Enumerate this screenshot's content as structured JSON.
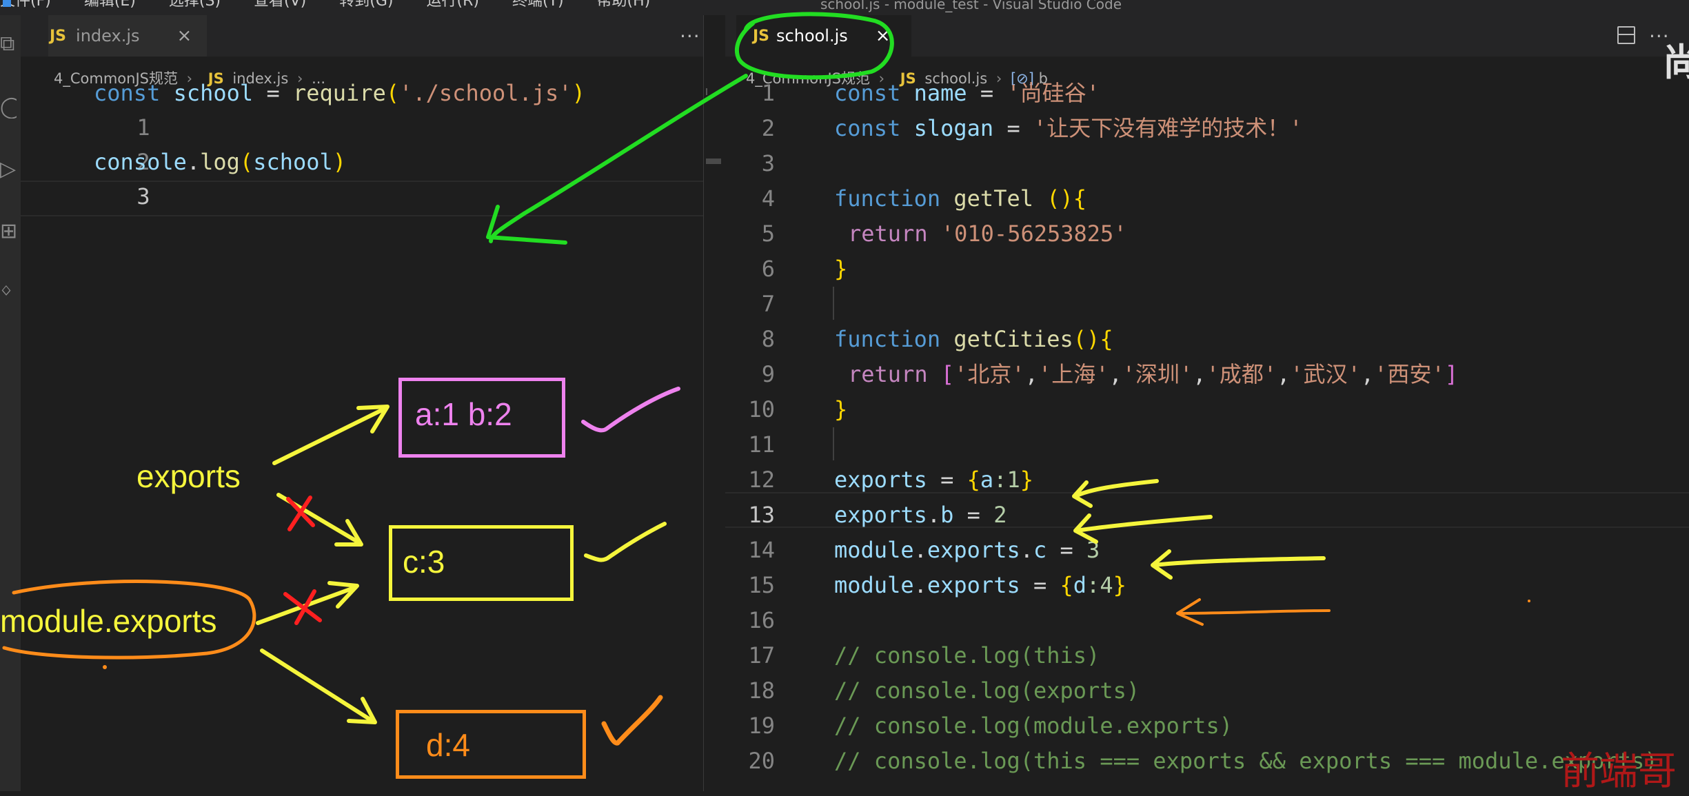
{
  "window": {
    "title": "school.js - module_test - Visual Studio Code",
    "menu": [
      "文件(F)",
      "编辑(E)",
      "选择(S)",
      "查看(V)",
      "转到(G)",
      "运行(R)",
      "终端(T)",
      "帮助(H)"
    ]
  },
  "left_editor": {
    "tab": {
      "badge": "JS",
      "label": "index.js",
      "close": "×"
    },
    "more": "···",
    "breadcrumb": {
      "folder": "4_CommonJS规范",
      "badge": "JS",
      "file": "index.js",
      "tail": "..."
    },
    "lines": [
      {
        "n": "1",
        "t1": "const",
        "t2": "school",
        "t3": " = ",
        "t4": "require",
        "t5": "(",
        "t6": "'./school.js'",
        "t7": ")"
      },
      {
        "n": "2"
      },
      {
        "n": "3",
        "t1": "console",
        "t2": ".",
        "t3": "log",
        "t4": "(",
        "t5": "school",
        "t6": ")"
      }
    ]
  },
  "right_editor": {
    "tab": {
      "badge": "JS",
      "label": "school.js",
      "close": "×"
    },
    "more": "···",
    "breadcrumb": {
      "folder": "4_CommonJS规范",
      "badge": "JS",
      "file": "school.js",
      "symbol_icon": "[⊘]",
      "symbol": "b"
    },
    "lines": [
      {
        "n": "1",
        "a": "const",
        "b": "name",
        "c": " = ",
        "d": "'尚硅谷'"
      },
      {
        "n": "2",
        "a": "const",
        "b": "slogan",
        "c": " = ",
        "d": "'让天下没有难学的技术！'"
      },
      {
        "n": "3"
      },
      {
        "n": "4",
        "a": "function",
        "b": "getTel",
        "c": " ",
        "d": "(){"
      },
      {
        "n": "5",
        "a": "return",
        "b": "'010-56253825'"
      },
      {
        "n": "6",
        "a": "}"
      },
      {
        "n": "7"
      },
      {
        "n": "8",
        "a": "function",
        "b": "getCities",
        "c": "(){"
      },
      {
        "n": "9",
        "a": "return",
        "b": "[",
        "c": "'北京'",
        "d": "'上海'",
        "e": "'深圳'",
        "f": "'成都'",
        "g": "'武汉'",
        "h": "'西安'",
        "i": "]",
        "sep": ","
      },
      {
        "n": "10",
        "a": "}"
      },
      {
        "n": "11"
      },
      {
        "n": "12",
        "a": "exports",
        "b": " = ",
        "c": "{",
        "d": "a",
        "e": ":1",
        "f": "}"
      },
      {
        "n": "13",
        "a": "exports",
        "b": ".",
        "c": "b",
        "d": " = ",
        "e": "2"
      },
      {
        "n": "14",
        "a": "module",
        "b": ".",
        "c": "exports",
        "d": ".",
        "e": "c",
        "f": " = ",
        "g": "3"
      },
      {
        "n": "15",
        "a": "module",
        "b": ".",
        "c": "exports",
        "d": " = ",
        "e": "{",
        "f": "d",
        "g": ":4",
        "h": "}"
      },
      {
        "n": "16"
      },
      {
        "n": "17",
        "a": "// console.log(this)"
      },
      {
        "n": "18",
        "a": "// console.log(exports)"
      },
      {
        "n": "19",
        "a": "// console.log(module.exports)"
      },
      {
        "n": "20",
        "a": "// console.log(this === exports && exports === module.exports)"
      }
    ]
  },
  "annotations": {
    "exports_label": "exports",
    "module_exports_label": "module.exports",
    "box_ab": "a:1  b:2",
    "box_c": "c:3",
    "box_d": "d:4",
    "colors": {
      "green": "#22dd22",
      "yellow": "#f5f53c",
      "pink": "#ee82ee",
      "orange": "#ff8c1a",
      "red": "#ff2020"
    }
  },
  "watermark": "前端哥",
  "peek_char": "尚"
}
